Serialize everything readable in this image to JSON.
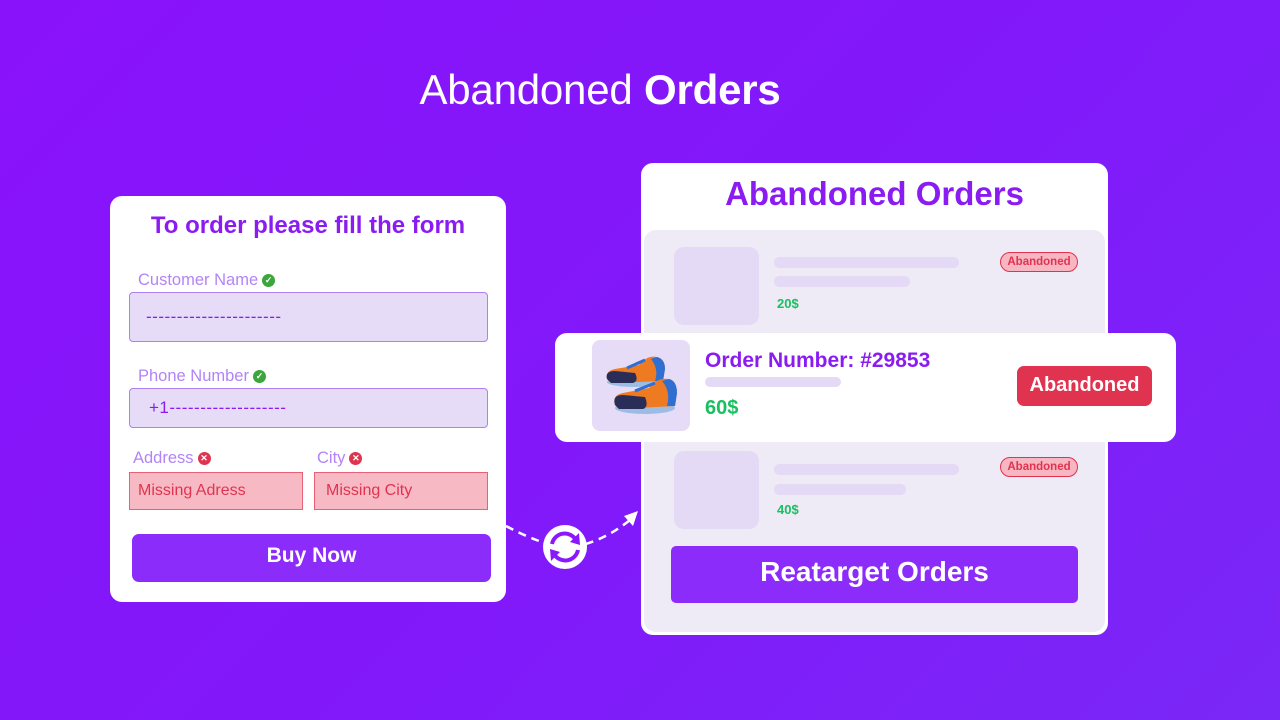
{
  "headline": {
    "regular": "Abandoned",
    "bold": "Orders"
  },
  "form": {
    "title": "To order please fill the form",
    "fields": [
      {
        "label": "Customer Name",
        "value": "----------------------",
        "status": "valid",
        "status_icon": "check-circle-icon"
      },
      {
        "label": "Phone Number",
        "value": "+1-------------------",
        "status": "valid",
        "status_icon": "check-circle-icon"
      },
      {
        "label": "Address",
        "value": "Missing Adress",
        "status": "invalid",
        "status_icon": "x-circle-icon"
      },
      {
        "label": "City",
        "value": "Missing City",
        "status": "invalid",
        "status_icon": "x-circle-icon"
      }
    ],
    "submit_label": "Buy Now"
  },
  "connector": {
    "icon": "sync-icon",
    "arrow": "dashed-arrow"
  },
  "orders": {
    "title": "Abandoned Orders",
    "list": [
      {
        "price": "20$",
        "status": "Abandoned"
      },
      {
        "price": "40$",
        "status": "Abandoned"
      }
    ],
    "highlighted": {
      "order_number": "Order Number: #29853",
      "price": "60$",
      "status": "Abandoned",
      "image": "sneakers-icon"
    },
    "action_label": "Reatarget Orders"
  },
  "colors": {
    "brand": "#8a1cf2",
    "button": "#8c2cfb",
    "success": "#18c060",
    "danger": "#e0334f",
    "valid_icon": "#3aa63b"
  }
}
